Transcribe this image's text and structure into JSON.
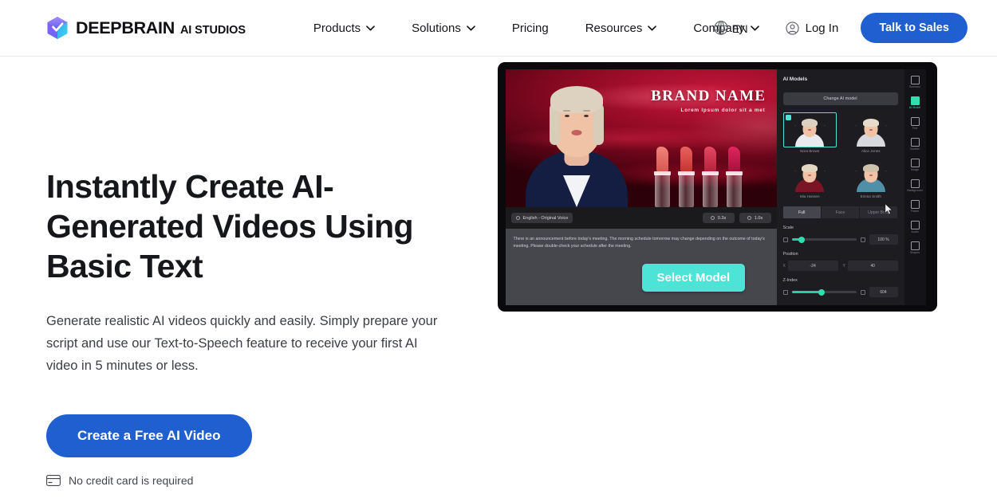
{
  "header": {
    "brand": {
      "name": "DEEPBRAIN",
      "sub": "AI STUDIOS",
      "logo_icon": "cube-logo-icon"
    },
    "nav": [
      {
        "label": "Products",
        "has_caret": true
      },
      {
        "label": "Solutions",
        "has_caret": true
      },
      {
        "label": "Pricing",
        "has_caret": false
      },
      {
        "label": "Resources",
        "has_caret": true
      },
      {
        "label": "Company",
        "has_caret": true
      }
    ],
    "language": {
      "label": "EN",
      "icon": "globe-icon"
    },
    "login": {
      "label": "Log In",
      "icon": "user-circle-icon"
    },
    "cta": {
      "label": "Talk to Sales"
    },
    "accent_blue": "#1f5fd0"
  },
  "hero": {
    "headline": "Instantly Create AI-Generated Videos Using Basic Text",
    "subcopy": "Generate realistic AI videos quickly and easily. Simply prepare your script and use our Text-to-Speech feature to receive your first AI video in 5 minutes or less.",
    "cta_label": "Create a Free AI Video",
    "note": "No credit card is required",
    "note_icon": "credit-card-icon"
  },
  "app_preview": {
    "stage": {
      "brand_title": "BRAND NAME",
      "brand_subtitle": "Lorem Ipsum dolor sit a met",
      "avatar_alt": "AI presenter avatar"
    },
    "toolbar": {
      "voice_chip": "English - Original Voice",
      "time_chip_1": "0.3s",
      "time_chip_2": "1.0s"
    },
    "script_text": "There is an announcement before today's meeting. The morning schedule tomorrow may change depending on the outcome of today's meeting. Please double-check your schedule after the meeting.",
    "select_model_label": "Select Model",
    "select_model_color": "#4ee3d7",
    "inspector": {
      "title": "AI Models",
      "change_button": "Change AI model",
      "models": [
        {
          "name": "Nora Brown",
          "selected": true,
          "body_color": "#e9eaee",
          "hair_color": "#ddd2c0"
        },
        {
          "name": "Alice Jones",
          "selected": false,
          "body_color": "#d8d9de",
          "hair_color": "#e6dcc9"
        },
        {
          "name": "Mia Hansen",
          "selected": false,
          "body_color": "#7a1526",
          "hair_color": "#e3d7c2"
        },
        {
          "name": "Emma Smith",
          "selected": false,
          "body_color": "#4f8fa8",
          "hair_color": "#cfc2ab"
        }
      ],
      "tabs": [
        {
          "label": "Full",
          "active": true
        },
        {
          "label": "Face",
          "active": false
        },
        {
          "label": "Upper Body",
          "active": false
        }
      ],
      "scale": {
        "label": "Scale",
        "value": "100 %",
        "percent": 16
      },
      "position": {
        "label": "Position",
        "x_axis": "X",
        "x_value": "-24",
        "y_axis": "Y",
        "y_value": "40"
      },
      "zindex": {
        "label": "Z-Index",
        "value": "604",
        "percent": 46
      }
    },
    "rail": [
      {
        "label": "Scenario",
        "active": false
      },
      {
        "label": "AI Model",
        "active": true
      },
      {
        "label": "Text",
        "active": false
      },
      {
        "label": "Subtitle",
        "active": false
      },
      {
        "label": "Image",
        "active": false
      },
      {
        "label": "Background",
        "active": false
      },
      {
        "label": "Frame",
        "active": false
      },
      {
        "label": "Audio",
        "active": false
      },
      {
        "label": "Shapes",
        "active": false
      }
    ]
  }
}
